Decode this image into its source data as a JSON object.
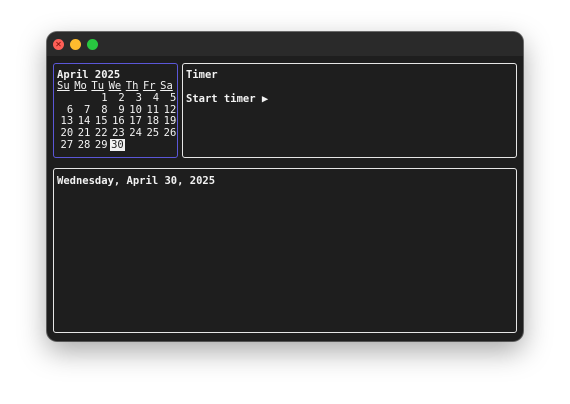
{
  "calendar": {
    "month_title": "April 2025",
    "weekdays": [
      "Su",
      "Mo",
      "Tu",
      "We",
      "Th",
      "Fr",
      "Sa"
    ],
    "weeks": [
      [
        "",
        "",
        "1",
        "2",
        "3",
        "4",
        "5"
      ],
      [
        "6",
        "7",
        "8",
        "9",
        "10",
        "11",
        "12"
      ],
      [
        "13",
        "14",
        "15",
        "16",
        "17",
        "18",
        "19"
      ],
      [
        "20",
        "21",
        "22",
        "23",
        "24",
        "25",
        "26"
      ],
      [
        "27",
        "28",
        "29",
        "30",
        "",
        "",
        ""
      ]
    ],
    "selected_day": "30",
    "accent_color": "#5b57d8"
  },
  "timer": {
    "title": "Timer",
    "start_label": "Start timer ▶"
  },
  "date_panel": {
    "date_text": "Wednesday, April 30, 2025"
  },
  "window": {
    "close_color": "#fe5f57",
    "minimize_color": "#febc2e",
    "maximize_color": "#28c840"
  }
}
